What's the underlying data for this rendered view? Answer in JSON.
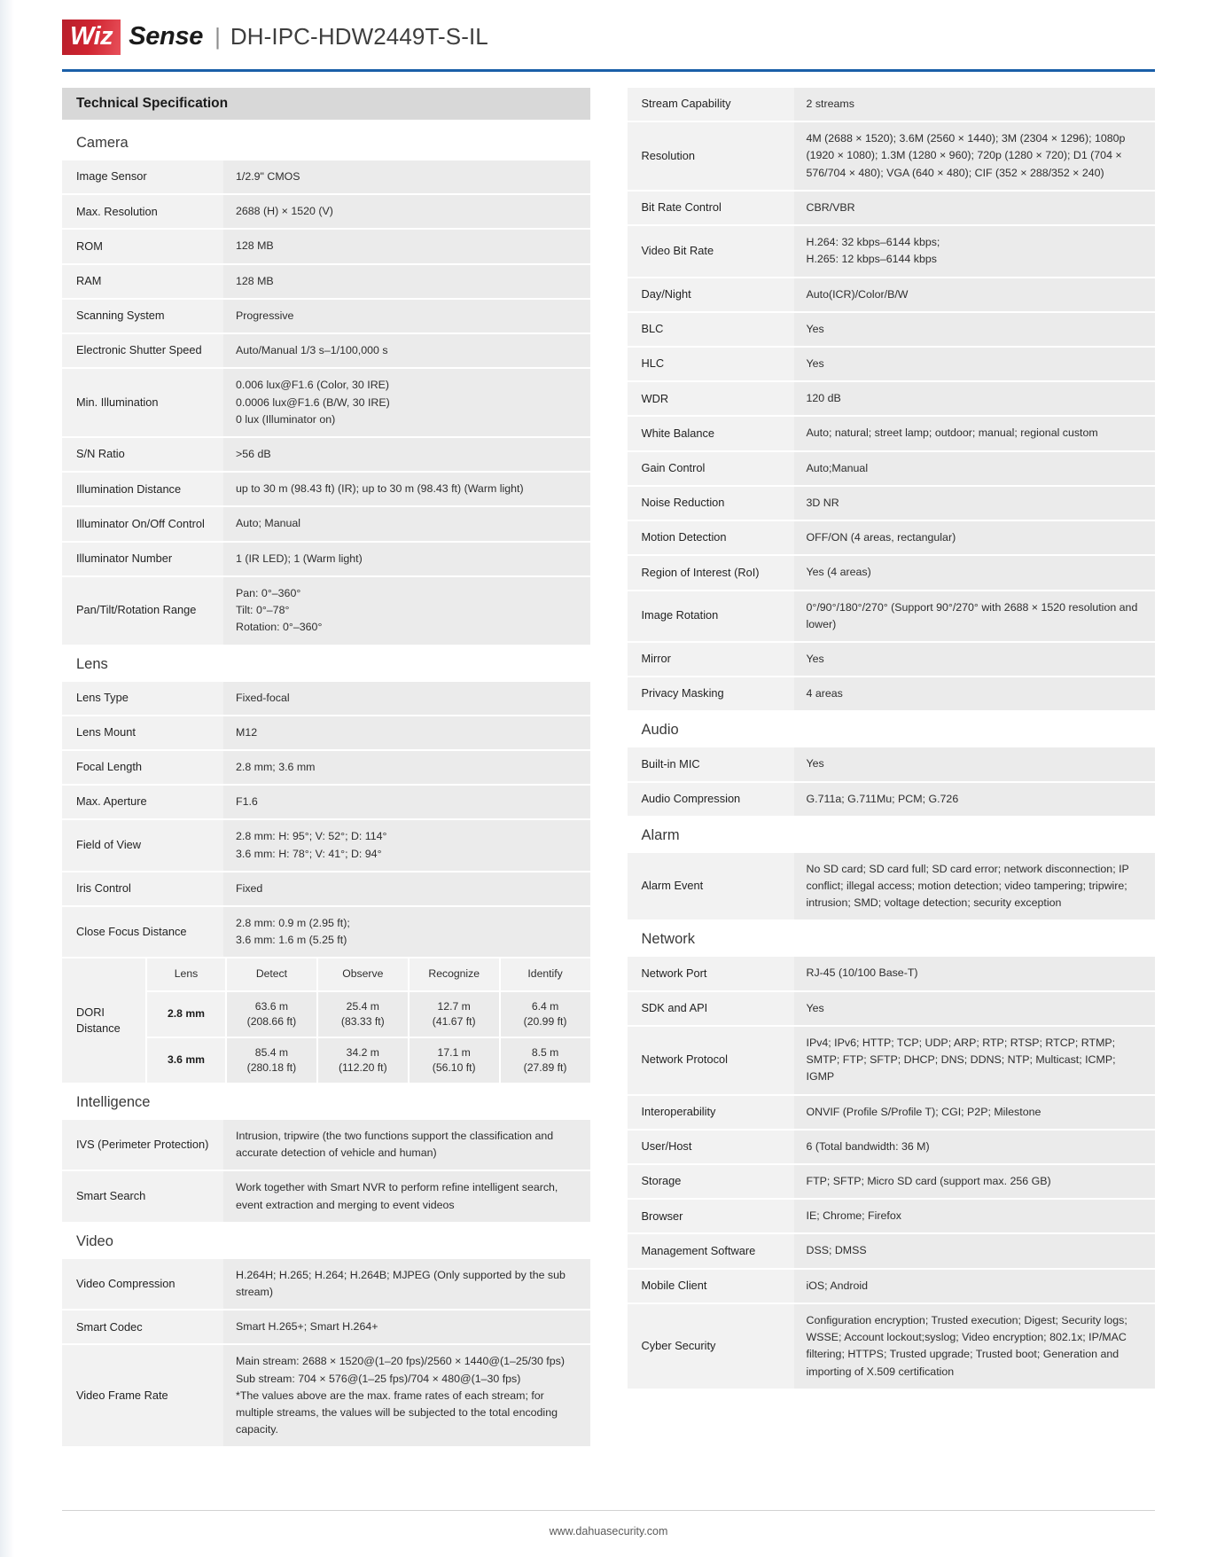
{
  "header": {
    "brand_badge": "Wiz",
    "brand_word": "Sense",
    "divider": "|",
    "model": "DH-IPC-HDW2449T-S-IL",
    "accent_color": "#1a5fa8",
    "badge_color": "#cf2430"
  },
  "spec_title": "Technical Specification",
  "footer": {
    "url": "www.dahuasecurity.com"
  },
  "left": {
    "groups": [
      {
        "name": "Camera",
        "rows": [
          {
            "key": "Image Sensor",
            "value": "1/2.9\" CMOS"
          },
          {
            "key": "Max. Resolution",
            "value": "2688 (H) × 1520 (V)"
          },
          {
            "key": "ROM",
            "value": "128 MB"
          },
          {
            "key": "RAM",
            "value": "128 MB"
          },
          {
            "key": "Scanning System",
            "value": "Progressive"
          },
          {
            "key": "Electronic Shutter Speed",
            "value": "Auto/Manual 1/3 s–1/100,000 s"
          },
          {
            "key": "Min. Illumination",
            "value": "0.006 lux@F1.6 (Color, 30 IRE)\n0.0006 lux@F1.6 (B/W, 30 IRE)\n0 lux (Illuminator on)"
          },
          {
            "key": "S/N Ratio",
            "value": ">56 dB"
          },
          {
            "key": "Illumination Distance",
            "value": "up to 30 m (98.43 ft) (IR); up to 30 m (98.43 ft) (Warm light)"
          },
          {
            "key": "Illuminator On/Off Control",
            "value": "Auto; Manual"
          },
          {
            "key": "Illuminator Number",
            "value": "1 (IR LED); 1 (Warm light)"
          },
          {
            "key": "Pan/Tilt/Rotation Range",
            "value": "Pan: 0°–360°\nTilt: 0°–78°\nRotation: 0°–360°"
          }
        ]
      },
      {
        "name": "Lens",
        "rows": [
          {
            "key": "Lens Type",
            "value": "Fixed-focal"
          },
          {
            "key": "Lens Mount",
            "value": "M12"
          },
          {
            "key": "Focal Length",
            "value": "2.8 mm; 3.6 mm"
          },
          {
            "key": "Max. Aperture",
            "value": "F1.6"
          },
          {
            "key": "Field of View",
            "value": "2.8 mm: H: 95°; V: 52°; D: 114°\n3.6 mm: H: 78°; V: 41°; D: 94°"
          },
          {
            "key": "Iris Control",
            "value": "Fixed"
          },
          {
            "key": "Close Focus Distance",
            "value": "2.8 mm: 0.9 m (2.95 ft);\n3.6 mm: 1.6 m (5.25 ft)"
          }
        ]
      }
    ],
    "dori": {
      "label": "DORI\nDistance",
      "columns": [
        "Lens",
        "Detect",
        "Observe",
        "Recognize",
        "Identify"
      ],
      "rows": [
        {
          "lens": "2.8 mm",
          "cells": [
            "63.6 m\n(208.66 ft)",
            "25.4 m\n(83.33 ft)",
            "12.7 m\n(41.67 ft)",
            "6.4 m\n(20.99 ft)"
          ]
        },
        {
          "lens": "3.6 mm",
          "cells": [
            "85.4 m\n(280.18 ft)",
            "34.2 m\n(112.20 ft)",
            "17.1 m\n(56.10 ft)",
            "8.5 m\n(27.89 ft)"
          ]
        }
      ]
    },
    "groups2": [
      {
        "name": "Intelligence",
        "rows": [
          {
            "key": "IVS (Perimeter Protection)",
            "value": "Intrusion, tripwire (the two functions support the classification and accurate detection of vehicle and human)"
          },
          {
            "key": "Smart Search",
            "value": "Work together with Smart NVR to perform refine intelligent search, event extraction and merging to event videos"
          }
        ]
      },
      {
        "name": "Video",
        "rows": [
          {
            "key": "Video Compression",
            "value": "H.264H; H.265; H.264; H.264B; MJPEG (Only supported by the sub stream)"
          },
          {
            "key": "Smart Codec",
            "value": "Smart H.265+; Smart H.264+"
          },
          {
            "key": "Video Frame Rate",
            "value": "Main stream: 2688 × 1520@(1–20 fps)/2560 × 1440@(1–25/30 fps)\nSub stream: 704 × 576@(1–25 fps)/704 × 480@(1–30 fps)\n*The values above are the max. frame rates of each stream; for multiple streams, the values will be subjected to the total encoding capacity."
          }
        ]
      }
    ]
  },
  "right": {
    "groups": [
      {
        "name": "",
        "rows": [
          {
            "key": "Stream Capability",
            "value": "2 streams"
          },
          {
            "key": "Resolution",
            "value": "4M (2688 × 1520); 3.6M (2560 × 1440); 3M (2304 × 1296); 1080p (1920 × 1080); 1.3M (1280 × 960); 720p (1280 × 720); D1 (704 × 576/704 × 480); VGA (640 × 480); CIF (352 × 288/352 × 240)"
          },
          {
            "key": "Bit Rate Control",
            "value": "CBR/VBR"
          },
          {
            "key": "Video Bit Rate",
            "value": "H.264: 32 kbps–6144 kbps;\nH.265: 12 kbps–6144 kbps"
          },
          {
            "key": "Day/Night",
            "value": "Auto(ICR)/Color/B/W"
          },
          {
            "key": "BLC",
            "value": "Yes"
          },
          {
            "key": "HLC",
            "value": "Yes"
          },
          {
            "key": "WDR",
            "value": "120 dB"
          },
          {
            "key": "White Balance",
            "value": "Auto; natural; street lamp; outdoor; manual; regional custom"
          },
          {
            "key": "Gain Control",
            "value": "Auto;Manual"
          },
          {
            "key": "Noise Reduction",
            "value": "3D NR"
          },
          {
            "key": "Motion Detection",
            "value": "OFF/ON (4 areas, rectangular)"
          },
          {
            "key": "Region of Interest (RoI)",
            "value": "Yes (4 areas)"
          },
          {
            "key": "Image Rotation",
            "value": "0°/90°/180°/270° (Support 90°/270° with 2688 × 1520 resolution and lower)"
          },
          {
            "key": "Mirror",
            "value": "Yes"
          },
          {
            "key": "Privacy Masking",
            "value": "4 areas"
          }
        ]
      },
      {
        "name": "Audio",
        "rows": [
          {
            "key": "Built-in MIC",
            "value": "Yes"
          },
          {
            "key": "Audio Compression",
            "value": "G.711a; G.711Mu; PCM; G.726"
          }
        ]
      },
      {
        "name": "Alarm",
        "rows": [
          {
            "key": "Alarm Event",
            "value": "No SD card; SD card full; SD card error; network disconnection; IP conflict; illegal access; motion detection; video tampering; tripwire; intrusion; SMD; voltage detection; security exception"
          }
        ]
      },
      {
        "name": "Network",
        "rows": [
          {
            "key": "Network Port",
            "value": "RJ-45 (10/100 Base-T)"
          },
          {
            "key": "SDK and API",
            "value": "Yes"
          },
          {
            "key": "Network Protocol",
            "value": "IPv4; IPv6; HTTP; TCP; UDP; ARP; RTP; RTSP; RTCP; RTMP; SMTP; FTP; SFTP; DHCP; DNS; DDNS; NTP; Multicast; ICMP; IGMP"
          },
          {
            "key": "Interoperability",
            "value": "ONVIF (Profile S/Profile T); CGI; P2P; Milestone"
          },
          {
            "key": "User/Host",
            "value": "6 (Total bandwidth: 36 M)"
          },
          {
            "key": "Storage",
            "value": "FTP; SFTP; Micro SD card (support max. 256 GB)"
          },
          {
            "key": "Browser",
            "value": "IE; Chrome; Firefox"
          },
          {
            "key": "Management Software",
            "value": "DSS; DMSS"
          },
          {
            "key": "Mobile Client",
            "value": "iOS; Android"
          },
          {
            "key": "Cyber Security",
            "value": "Configuration encryption; Trusted execution; Digest; Security logs; WSSE; Account lockout;syslog; Video encryption; 802.1x; IP/MAC filtering; HTTPS; Trusted upgrade; Trusted boot; Generation and importing of X.509 certification"
          }
        ]
      }
    ]
  }
}
